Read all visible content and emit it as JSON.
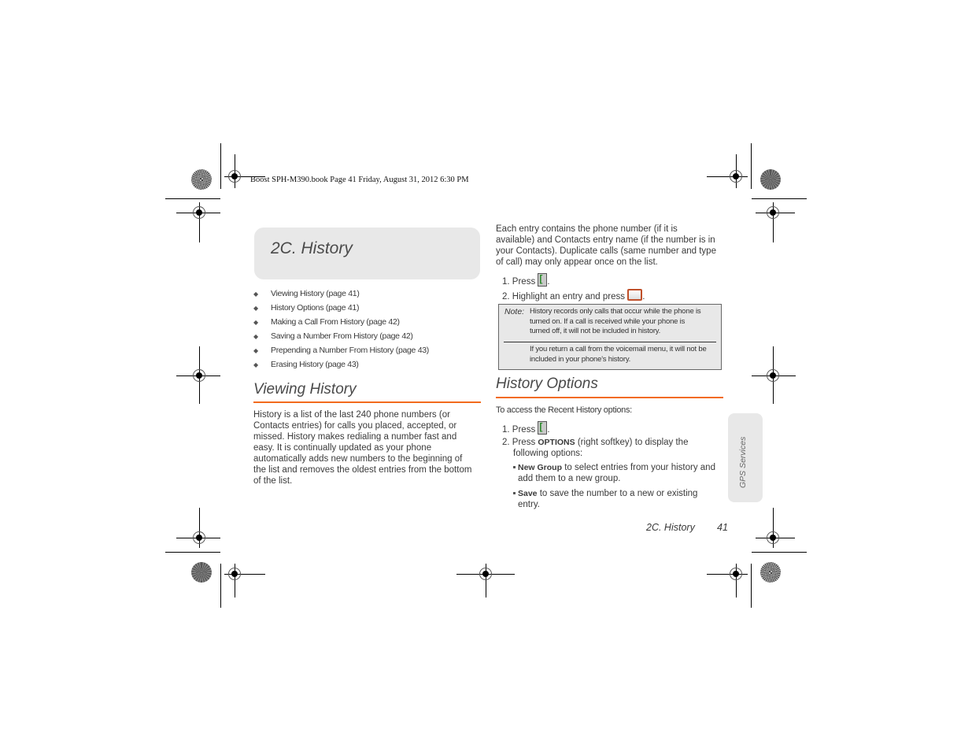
{
  "print_header": "Boost SPH-M390.book  Page 41  Friday, August 31, 2012  6:30 PM",
  "chapter": {
    "title": "2C. History"
  },
  "toc": [
    "Viewing History (page 41)",
    "History Options (page 41)",
    "Making a Call From History (page 42)",
    "Saving a Number From History (page 42)",
    "Prepending a Number From History (page 43)",
    "Erasing History (page 43)"
  ],
  "viewing_history": {
    "title": "Viewing History",
    "paragraph_lines": [
      "History is a list of the last 240 phone numbers (or",
      "Contacts entries) for calls you placed, accepted, or",
      "missed. History makes redialing a number fast and",
      "easy. It is continually updated as your phone",
      "automatically adds new numbers to the beginning of",
      "the list and removes the oldest entries from the bottom",
      "of the list."
    ]
  },
  "entry_info": {
    "paragraph_lines": [
      "Each entry contains the phone number (if it is",
      "available) and Contacts entry name (if the number is in",
      "your Contacts). Duplicate calls (same number and type",
      "of call) may only appear once on the list."
    ],
    "steps": [
      {
        "num": "1.",
        "text": "Press",
        "key": "talk-key",
        "suffix": "."
      },
      {
        "num": "2.",
        "text": "Highlight an entry and press",
        "key": "menu-ok-key",
        "suffix": "."
      }
    ]
  },
  "note": {
    "label": "Note:",
    "lines_1": [
      "History records only calls that occur while the phone is",
      "turned on. If a call is received while your phone is",
      "turned off, it will not be included in history."
    ],
    "lines_2": [
      "If you return a call from the voicemail menu, it will not be",
      "included in your phone's history."
    ]
  },
  "history_options": {
    "title": "History Options",
    "intro": "To access the Recent History options:",
    "step1": {
      "num": "1.",
      "text": "Press",
      "suffix": "."
    },
    "step2": {
      "num": "2.",
      "pre": "Press ",
      "bold": "OPTIONS",
      "post": " (right softkey) to display the",
      "line2": "following options:"
    },
    "options": [
      {
        "bold": "New Group",
        "text": " to select entries from your history and",
        "line2": "add them to a new group."
      },
      {
        "bold": "Save",
        "text": " to save the number to a new or existing",
        "line2": "entry."
      }
    ]
  },
  "side_tab": {
    "label": "GPS Services"
  },
  "footer": {
    "section": "2C. History",
    "page": "41"
  },
  "colors": {
    "accent_rule": "#f26b1d",
    "box_gray": "#e8e8e8"
  }
}
